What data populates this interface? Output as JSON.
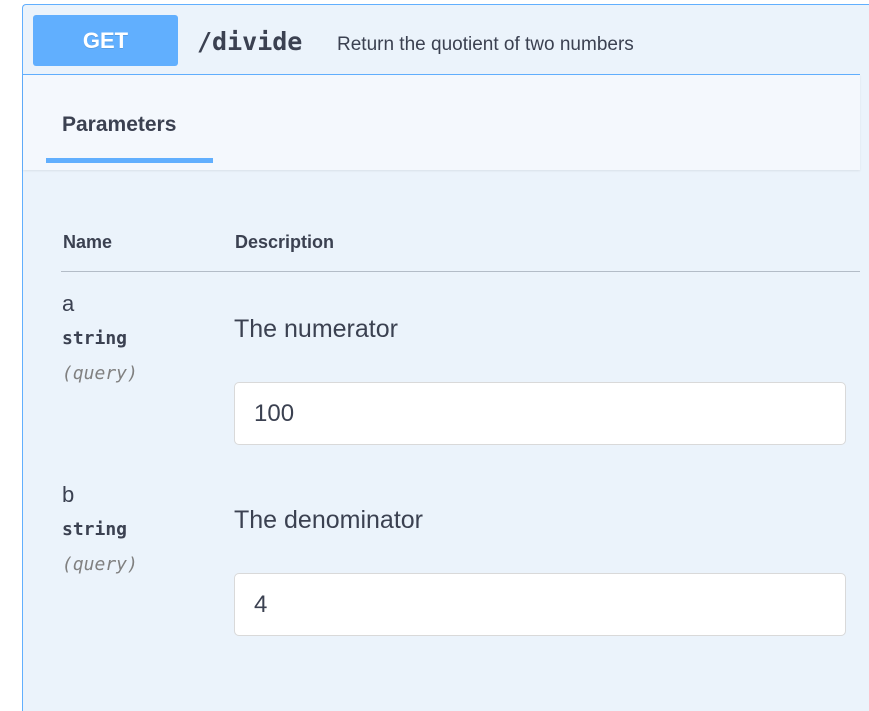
{
  "operation": {
    "method": "GET",
    "path": "/divide",
    "summary": "Return the quotient of two numbers"
  },
  "colors": {
    "get_accent": "#61affe",
    "block_background": "#ebf3fb",
    "text": "#3b4151",
    "muted": "#808080"
  },
  "tabs": {
    "parameters_label": "Parameters"
  },
  "table": {
    "columns": {
      "name": "Name",
      "description": "Description"
    }
  },
  "parameters": [
    {
      "name": "a",
      "type": "string",
      "in": "(query)",
      "description": "The numerator",
      "value": "100"
    },
    {
      "name": "b",
      "type": "string",
      "in": "(query)",
      "description": "The denominator",
      "value": "4"
    }
  ]
}
